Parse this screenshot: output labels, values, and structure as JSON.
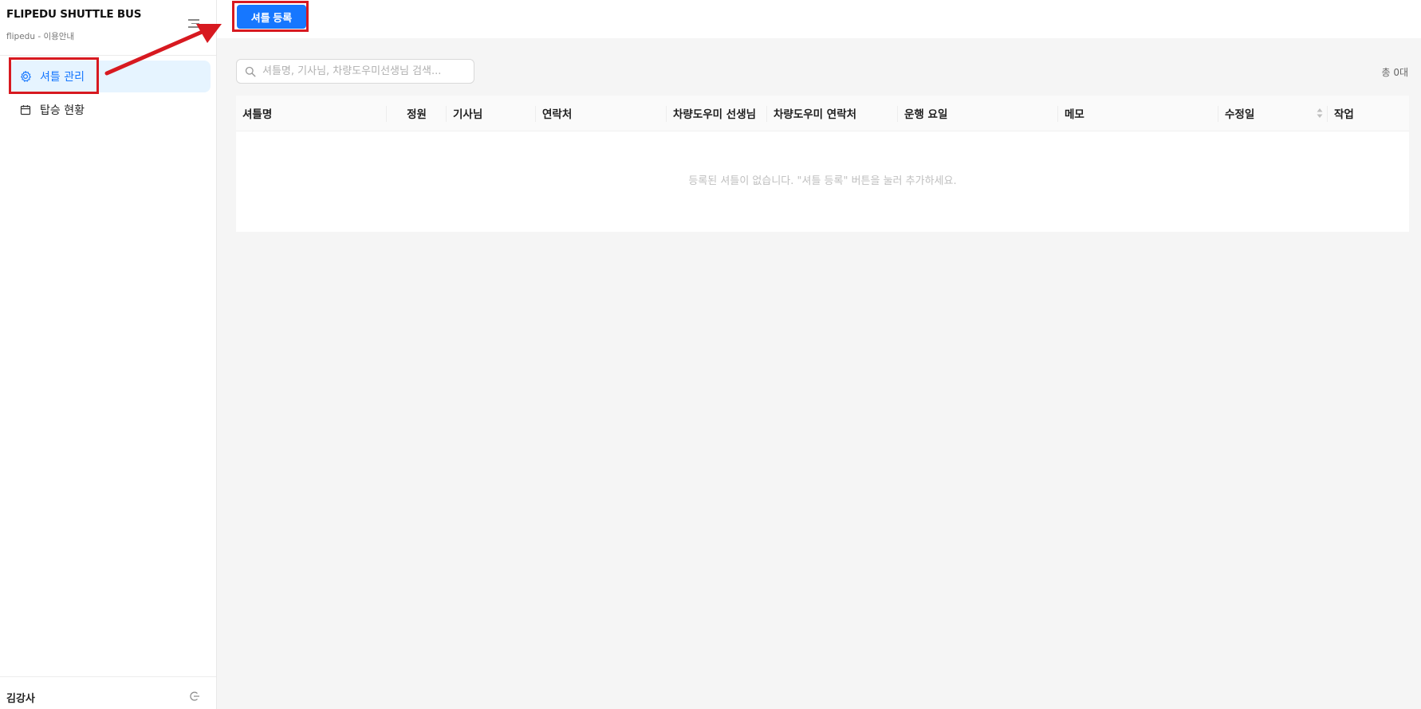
{
  "sidebar": {
    "title": "FLIPEDU SHUTTLE BUS",
    "subtitle": "flipedu - 이용안내",
    "items": [
      {
        "label": "셔틀 관리",
        "icon": "gear-icon",
        "active": true
      },
      {
        "label": "탑승 현황",
        "icon": "calendar-icon",
        "active": false
      }
    ],
    "user_name": "김강사"
  },
  "toolbar": {
    "register_label": "셔틀 등록"
  },
  "search": {
    "placeholder": "셔틀명, 기사님, 차량도우미선생님 검색..."
  },
  "summary": {
    "total": "총 0대"
  },
  "table": {
    "columns": [
      "셔틀명",
      "정원",
      "기사님",
      "연락처",
      "차량도우미 선생님",
      "차량도우미 연락처",
      "운행 요일",
      "메모",
      "수정일",
      "작업"
    ],
    "empty_message": "등록된 셔틀이 없습니다. \"셔틀 등록\" 버튼을 눌러 추가하세요."
  },
  "colors": {
    "primary": "#1677ff",
    "active_bg": "#e6f4ff",
    "highlight": "#d71920"
  }
}
